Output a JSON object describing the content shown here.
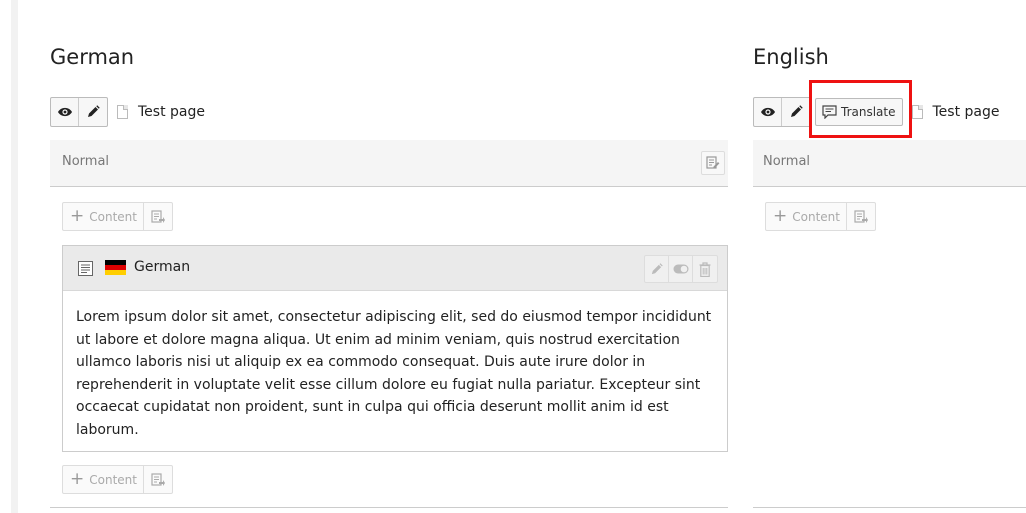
{
  "columns": {
    "german": {
      "language": "German",
      "page_title": "Test page",
      "section_label": "Normal",
      "content_button_label": "Content",
      "card": {
        "title": "German",
        "flag_colors": [
          "#000000",
          "#dd0000",
          "#ffce00"
        ],
        "body": "Lorem ipsum dolor sit amet, consectetur adipiscing elit, sed do eiusmod tempor incididunt ut labore et dolore magna aliqua. Ut enim ad minim veniam, quis nostrud exercitation ullamco laboris nisi ut aliquip ex ea commodo consequat. Duis aute irure dolor in reprehenderit in voluptate velit esse cillum dolore eu fugiat nulla pariatur. Excepteur sint occaecat cupidatat non proident, sunt in culpa qui officia deserunt mollit anim id est laborum."
      }
    },
    "english": {
      "language": "English",
      "translate_label": "Translate",
      "page_title": "Test page",
      "section_label": "Normal",
      "content_button_label": "Content"
    }
  },
  "icons": {
    "view": "eye-icon",
    "edit": "pencil-icon",
    "page": "page-icon",
    "translate": "translate-icon",
    "content_side": "content-wizard-icon",
    "card_type": "text-element-icon",
    "card_actions": [
      "pencil-icon",
      "toggle-icon",
      "trash-icon"
    ]
  },
  "colors": {
    "highlight": "#ee1111",
    "section_background": "#f5f5f5",
    "card_header_background": "#eaeaea"
  }
}
